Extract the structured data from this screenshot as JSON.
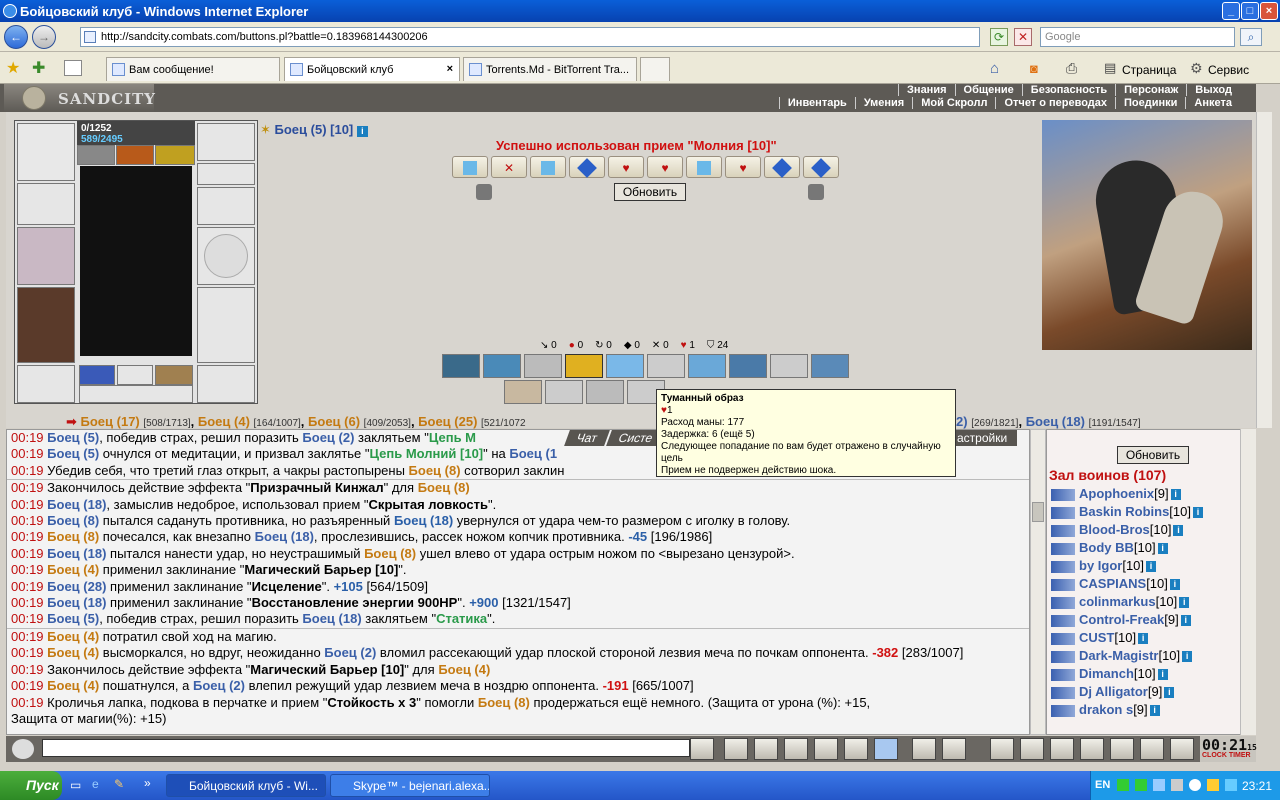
{
  "window": {
    "title": "Бойцовский клуб - Windows Internet Explorer"
  },
  "browser": {
    "url": "http://sandcity.combats.com/buttons.pl?battle=0.183968144300206",
    "search_placeholder": "Google",
    "tabs": [
      "Вам сообщение!",
      "Бойцовский клуб",
      "Torrents.Md - BitTorrent Tra..."
    ],
    "toolbar_page": "Страница",
    "toolbar_service": "Сервис"
  },
  "game": {
    "logo": "SANDCITY",
    "menu_top": [
      "Знания",
      "Общение",
      "Безопасность",
      "Персонаж",
      "Выход"
    ],
    "menu_bottom": [
      "Инвентарь",
      "Умения",
      "Мой Скролл",
      "Отчет о переводах",
      "Поединки",
      "Анкета"
    ],
    "char_hp": "0/1252",
    "char_mp": "589/2495",
    "fighter_title": "Боец (5) [10]",
    "success_msg": "Успешно использован прием \"Молния [10]\"",
    "refresh_label": "Обновить",
    "counters": [
      "0",
      "0",
      "0",
      "0",
      "0",
      "1",
      "24"
    ],
    "fighters_line": [
      {
        "name": "Боец (17)",
        "hp": "[508/1713]"
      },
      {
        "name": "Боец (4)",
        "hp": "[164/1007]"
      },
      {
        "name": "Боец (6)",
        "hp": "[409/2053]"
      },
      {
        "name": "Боец (25)",
        "hp": "[521/1072"
      }
    ],
    "fighters_line_right": [
      {
        "name": "2)",
        "hp": "[269/1821]"
      },
      {
        "name": "Боец (18)",
        "hp": "[1191/1547]"
      }
    ],
    "tooltip": {
      "title": "Туманный образ",
      "l1": "1",
      "l2": "Расход маны: 177",
      "l3": "Задержка: 6 (ещё 5)",
      "l4": "Следующее попадание по вам будет отражено в случайную цель",
      "l5": "Прием не подвержен действию шока."
    },
    "chat_tabs": [
      "Чат",
      "Систе"
    ],
    "chat_settings": "астройки",
    "hall_title": "Зал воинов (107)",
    "players": [
      {
        "name": "Apophoenix",
        "lv": "[9]"
      },
      {
        "name": "Baskin Robins",
        "lv": "[10]"
      },
      {
        "name": "Blood-Bros",
        "lv": "[10]"
      },
      {
        "name": "Body BB",
        "lv": "[10]"
      },
      {
        "name": "by Igor",
        "lv": "[10]"
      },
      {
        "name": "CASPIANS",
        "lv": "[10]"
      },
      {
        "name": "colinmarkus",
        "lv": "[10]"
      },
      {
        "name": "Control-Freak",
        "lv": "[9]"
      },
      {
        "name": "CUST",
        "lv": "[10]"
      },
      {
        "name": "Dark-Magistr",
        "lv": "[10]"
      },
      {
        "name": "Dimanch",
        "lv": "[10]"
      },
      {
        "name": "Dj Alligator",
        "lv": "[9]"
      },
      {
        "name": "drakon s",
        "lv": "[9]"
      }
    ],
    "clock": "00:21",
    "clock_sec": "15",
    "clock_label": "CLOCK TIMER"
  },
  "log": [
    {
      "t": "00:19",
      "p": [
        [
          "b",
          "Боец (5)"
        ],
        [
          "n",
          ", победив страх, решил поразить "
        ],
        [
          "b",
          "Боец (2)"
        ],
        [
          "n",
          " заклятьем \""
        ],
        [
          "g",
          "Цепь М"
        ]
      ]
    },
    {
      "t": "00:19",
      "p": [
        [
          "b",
          "Боец (5)"
        ],
        [
          "n",
          " очнулся от медитации, и призвал заклятье \""
        ],
        [
          "g",
          "Цепь Молний [10]"
        ],
        [
          "n",
          "\" на "
        ],
        [
          "b",
          "Боец (1"
        ]
      ]
    },
    {
      "t": "00:19",
      "p": [
        [
          "n",
          "Убедив себя, что третий глаз открыт, а чакры растопырены "
        ],
        [
          "o",
          "Боец (8)"
        ],
        [
          "n",
          " сотворил заклин"
        ]
      ]
    },
    {
      "t": "00:19",
      "sep": true,
      "p": [
        [
          "n",
          "Закончилось действие эффекта \""
        ],
        [
          "k",
          "Призрачный Кинжал"
        ],
        [
          "n",
          "\" для "
        ],
        [
          "o",
          "Боец (8)"
        ]
      ]
    },
    {
      "t": "00:19",
      "p": [
        [
          "b",
          "Боец (18)"
        ],
        [
          "n",
          ", замыслив недоброе, использовал прием \""
        ],
        [
          "k",
          "Скрытая ловкость"
        ],
        [
          "n",
          "\"."
        ]
      ]
    },
    {
      "t": "00:19",
      "p": [
        [
          "b",
          "Боец (8)"
        ],
        [
          "n",
          " пытался садануть противника, но разъяренный "
        ],
        [
          "bl",
          "Боец (18)"
        ],
        [
          "n",
          " увернулся от удара чем-то размером с иголку в голову."
        ]
      ]
    },
    {
      "t": "00:19",
      "p": [
        [
          "o",
          "Боец (8)"
        ],
        [
          "n",
          " почесался, как внезапно "
        ],
        [
          "b",
          "Боец (18)"
        ],
        [
          "n",
          ", прослезившись, рассек ножом копчик противника. "
        ],
        [
          "bl",
          "-45"
        ],
        [
          "n",
          " [196/1986]"
        ]
      ]
    },
    {
      "t": "00:19",
      "p": [
        [
          "b",
          "Боец (18)"
        ],
        [
          "n",
          " пытался нанести удар, но неустрашимый "
        ],
        [
          "o",
          "Боец (8)"
        ],
        [
          "n",
          " ушел влево от удара острым ножом по <вырезано цензурой>."
        ]
      ]
    },
    {
      "t": "00:19",
      "p": [
        [
          "o",
          "Боец (4)"
        ],
        [
          "n",
          " применил заклинание \""
        ],
        [
          "k",
          "Магический Барьер [10]"
        ],
        [
          "n",
          "\"."
        ]
      ]
    },
    {
      "t": "00:19",
      "p": [
        [
          "b",
          "Боец (28)"
        ],
        [
          "n",
          " применил заклинание \""
        ],
        [
          "k",
          "Исцеление"
        ],
        [
          "n",
          "\". "
        ],
        [
          "bl",
          "+105"
        ],
        [
          "n",
          " [564/1509]"
        ]
      ]
    },
    {
      "t": "00:19",
      "p": [
        [
          "b",
          "Боец (18)"
        ],
        [
          "n",
          " применил заклинание \""
        ],
        [
          "k",
          "Восстановление энергии 900HP"
        ],
        [
          "n",
          "\". "
        ],
        [
          "bl",
          "+900"
        ],
        [
          "n",
          " [1321/1547]"
        ]
      ]
    },
    {
      "t": "00:19",
      "p": [
        [
          "b",
          "Боец (5)"
        ],
        [
          "n",
          ", победив страх, решил поразить "
        ],
        [
          "b",
          "Боец (18)"
        ],
        [
          "n",
          " заклятьем \""
        ],
        [
          "g",
          "Статика"
        ],
        [
          "n",
          "\"."
        ]
      ]
    },
    {
      "t": "00:19",
      "sep": true,
      "p": [
        [
          "o",
          "Боец (4)"
        ],
        [
          "n",
          " потратил свой ход на магию."
        ]
      ]
    },
    {
      "t": "00:19",
      "wrap": true,
      "p": [
        [
          "o",
          "Боец (4)"
        ],
        [
          "n",
          " высморкался, но вдруг, неожиданно "
        ],
        [
          "b",
          "Боец (2)"
        ],
        [
          "n",
          " вломил рассекающий удар плоской стороной лезвия меча по почкам оппонента. "
        ],
        [
          "r",
          "-382"
        ],
        [
          "n",
          " [283/1007]"
        ]
      ]
    },
    {
      "t": "00:19",
      "p": [
        [
          "n",
          "Закончилось действие эффекта \""
        ],
        [
          "k",
          "Магический Барьер [10]"
        ],
        [
          "n",
          "\" для "
        ],
        [
          "o",
          "Боец (4)"
        ]
      ]
    },
    {
      "t": "00:19",
      "p": [
        [
          "o",
          "Боец (4)"
        ],
        [
          "n",
          " пошатнулся, а "
        ],
        [
          "b",
          "Боец (2)"
        ],
        [
          "n",
          " влепил режущий удар лезвием меча в ноздрю оппонента. "
        ],
        [
          "r",
          "-191"
        ],
        [
          "n",
          " [665/1007]"
        ]
      ]
    },
    {
      "t": "00:19",
      "p": [
        [
          "n",
          "Кроличья лапка, подкова в перчатке и прием \""
        ],
        [
          "k",
          "Стойкость x 3"
        ],
        [
          "n",
          "\" помогли "
        ],
        [
          "o",
          "Боец (8)"
        ],
        [
          "n",
          " продержаться ещё немного. (Защита от урона (%): +15,"
        ]
      ]
    },
    {
      "t": "",
      "p": [
        [
          "n",
          "Защита от магии(%): +15)"
        ]
      ]
    }
  ],
  "taskbar": {
    "start": "Пуск",
    "tasks": [
      "Бойцовский клуб - Wi...",
      "Skype™ - bejenari.alexa..."
    ],
    "lang": "EN",
    "time": "23:21"
  }
}
